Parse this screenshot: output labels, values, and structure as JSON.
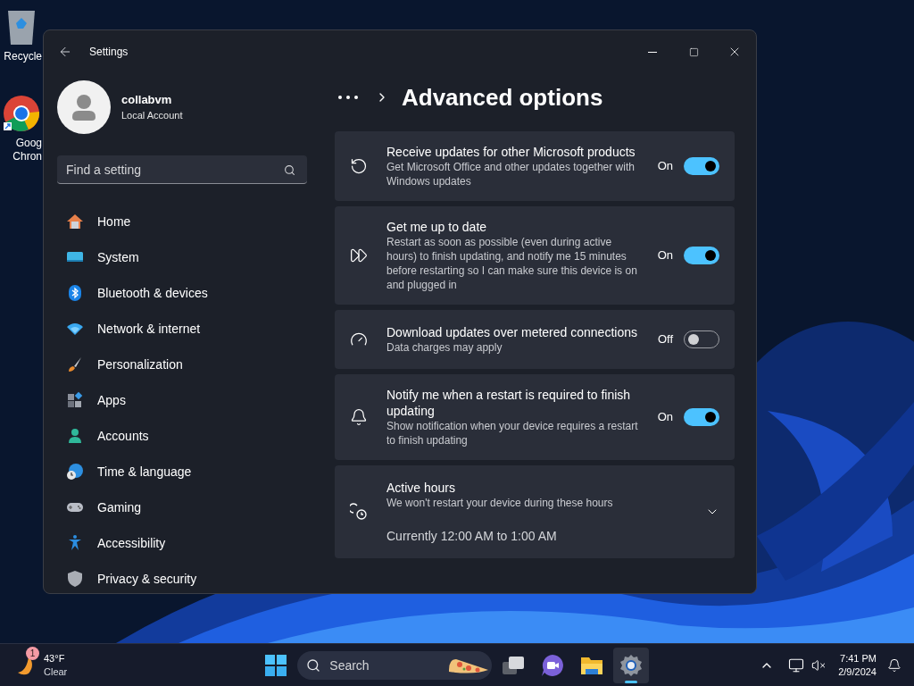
{
  "desktop": {
    "icons": [
      {
        "kind": "recycle",
        "lines": [
          "Recycle"
        ]
      },
      {
        "kind": "chrome",
        "lines": [
          "Goog",
          "Chron"
        ]
      }
    ]
  },
  "window": {
    "title": "Settings",
    "user": {
      "name": "collabvm",
      "account": "Local Account"
    },
    "search": {
      "placeholder": "Find a setting"
    },
    "sidebar": {
      "items": [
        {
          "label": "Home",
          "selected": false
        },
        {
          "label": "System",
          "selected": false
        },
        {
          "label": "Bluetooth & devices",
          "selected": false
        },
        {
          "label": "Network & internet",
          "selected": false
        },
        {
          "label": "Personalization",
          "selected": false
        },
        {
          "label": "Apps",
          "selected": false
        },
        {
          "label": "Accounts",
          "selected": false
        },
        {
          "label": "Time & language",
          "selected": false
        },
        {
          "label": "Gaming",
          "selected": false
        },
        {
          "label": "Accessibility",
          "selected": false
        },
        {
          "label": "Privacy & security",
          "selected": false
        }
      ]
    },
    "page_title": "Advanced options",
    "settings": [
      {
        "kind": "toggle",
        "title": "Receive updates for other Microsoft products",
        "description": "Get Microsoft Office and other updates together with Windows updates",
        "on": true,
        "state_label": "On"
      },
      {
        "kind": "toggle",
        "title": "Get me up to date",
        "description": "Restart as soon as possible (even during active hours) to finish updating, and notify me 15 minutes before restarting so I can make sure this device is on and plugged in",
        "on": true,
        "state_label": "On"
      },
      {
        "kind": "toggle",
        "title": "Download updates over metered connections",
        "description": "Data charges may apply",
        "on": false,
        "state_label": "Off"
      },
      {
        "kind": "toggle",
        "title": "Notify me when a restart is required to finish updating",
        "description": "Show notification when your device requires a restart to finish updating",
        "on": true,
        "state_label": "On"
      },
      {
        "kind": "expander",
        "title": "Active hours",
        "description": "We won't restart your device during these hours",
        "current": "Currently 12:00 AM to 1:00 AM",
        "expanded": false
      }
    ]
  },
  "taskbar": {
    "weather": {
      "badge": "1",
      "temperature": "43°F",
      "condition": "Clear"
    },
    "search": {
      "placeholder": "Search"
    },
    "apps": [
      {
        "kind": "taskview",
        "active": false
      },
      {
        "kind": "meet",
        "active": false
      },
      {
        "kind": "explorer",
        "active": false
      },
      {
        "kind": "settings",
        "active": true
      }
    ],
    "time": "7:41 PM",
    "date": "2/9/2024"
  }
}
